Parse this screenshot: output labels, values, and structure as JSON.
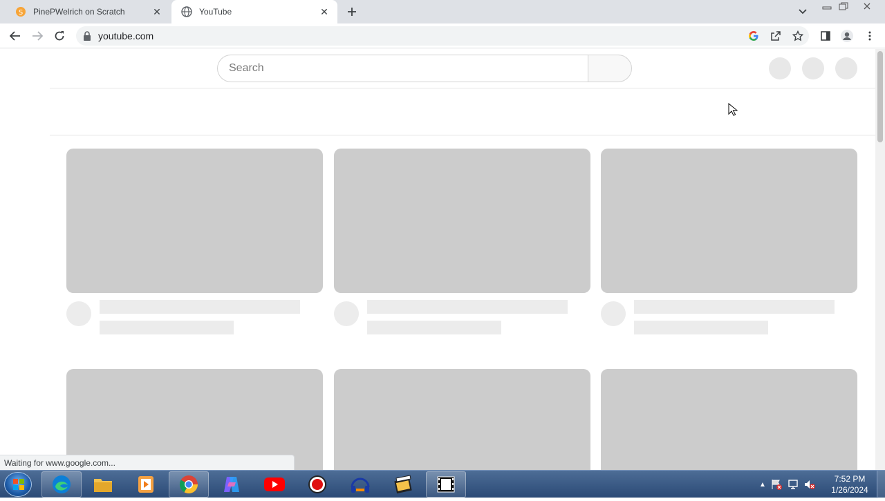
{
  "browser": {
    "tabs": [
      {
        "title": "PinePWelrich on Scratch",
        "active": false,
        "favicon": "scratch-icon"
      },
      {
        "title": "YouTube",
        "active": true,
        "favicon": "globe-icon"
      }
    ],
    "address": "youtube.com",
    "status_text": "Waiting for www.google.com..."
  },
  "youtube": {
    "search_placeholder": "Search",
    "skeleton_cards_rows": 2,
    "skeleton_cards_per_row": 3
  },
  "taskbar": {
    "items": [
      "start-orb",
      "edge-icon",
      "file-explorer-icon",
      "media-player-icon",
      "chrome-icon",
      "copilot-icon",
      "youtube-icon",
      "record-icon",
      "headphones-icon",
      "movie-maker-icon",
      "film-icon"
    ],
    "time": "7:52 PM",
    "date": "1/26/2024"
  },
  "colors": {
    "skeleton": "#cccccc",
    "skeleton_light": "#ececec",
    "youtube_red": "#ff0000",
    "chrome_tabstrip": "#dee1e6"
  }
}
